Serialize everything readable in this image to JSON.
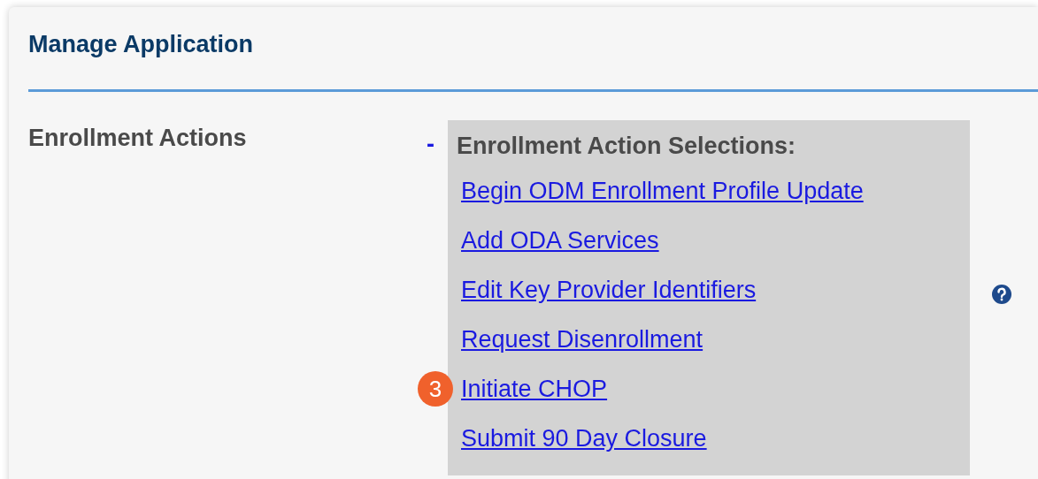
{
  "panel": {
    "title": "Manage Application"
  },
  "section": {
    "label": "Enrollment Actions",
    "toggle": "-",
    "selections": {
      "heading": "Enrollment Action Selections:",
      "links": [
        {
          "label": "Begin ODM Enrollment Profile Update"
        },
        {
          "label": "Add ODA Services"
        },
        {
          "label": "Edit Key Provider Identifiers"
        },
        {
          "label": "Request Disenrollment"
        },
        {
          "label": "Initiate CHOP",
          "callout": "3"
        },
        {
          "label": "Submit 90 Day Closure"
        }
      ]
    }
  }
}
